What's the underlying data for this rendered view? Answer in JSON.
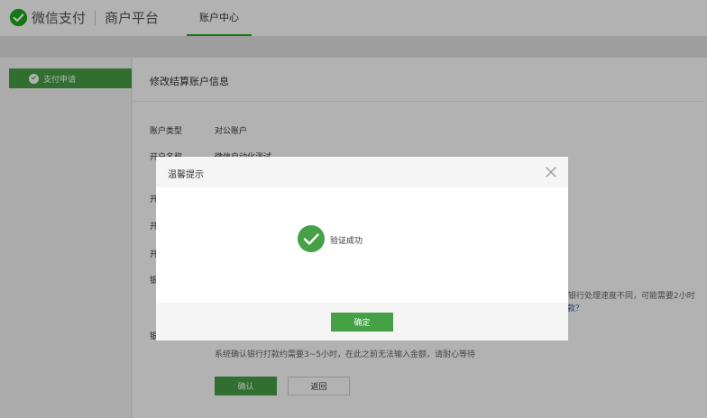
{
  "header": {
    "brand": "微信支付",
    "platform": "商户平台",
    "tab_account_center": "账户中心"
  },
  "sidebar": {
    "items": [
      {
        "label": "支付申请"
      }
    ]
  },
  "main": {
    "title": "修改结算账户信息",
    "fields": [
      {
        "label": "账户类型",
        "value": "对公账户"
      },
      {
        "label": "开户名称",
        "value": "微信自动化测试"
      }
    ],
    "partial_labels": [
      "开",
      "开",
      "开",
      "银",
      "银"
    ],
    "note": "系统确认银行打款约需要3~5小时，在此之前无法输入金额，请耐心等待",
    "right_tail_text": "银行处理速度不同，可能需要2小时",
    "right_link_text": "款？",
    "confirm_button": "确认",
    "back_button": "返回"
  },
  "modal": {
    "title": "温馨提示",
    "message": "验证成功",
    "ok_button": "确定",
    "close_icon": "close-icon",
    "success_icon": "check-circle-icon"
  },
  "colors": {
    "accent": "#45a046",
    "overlay": "rgba(0,0,0,0.3)"
  }
}
